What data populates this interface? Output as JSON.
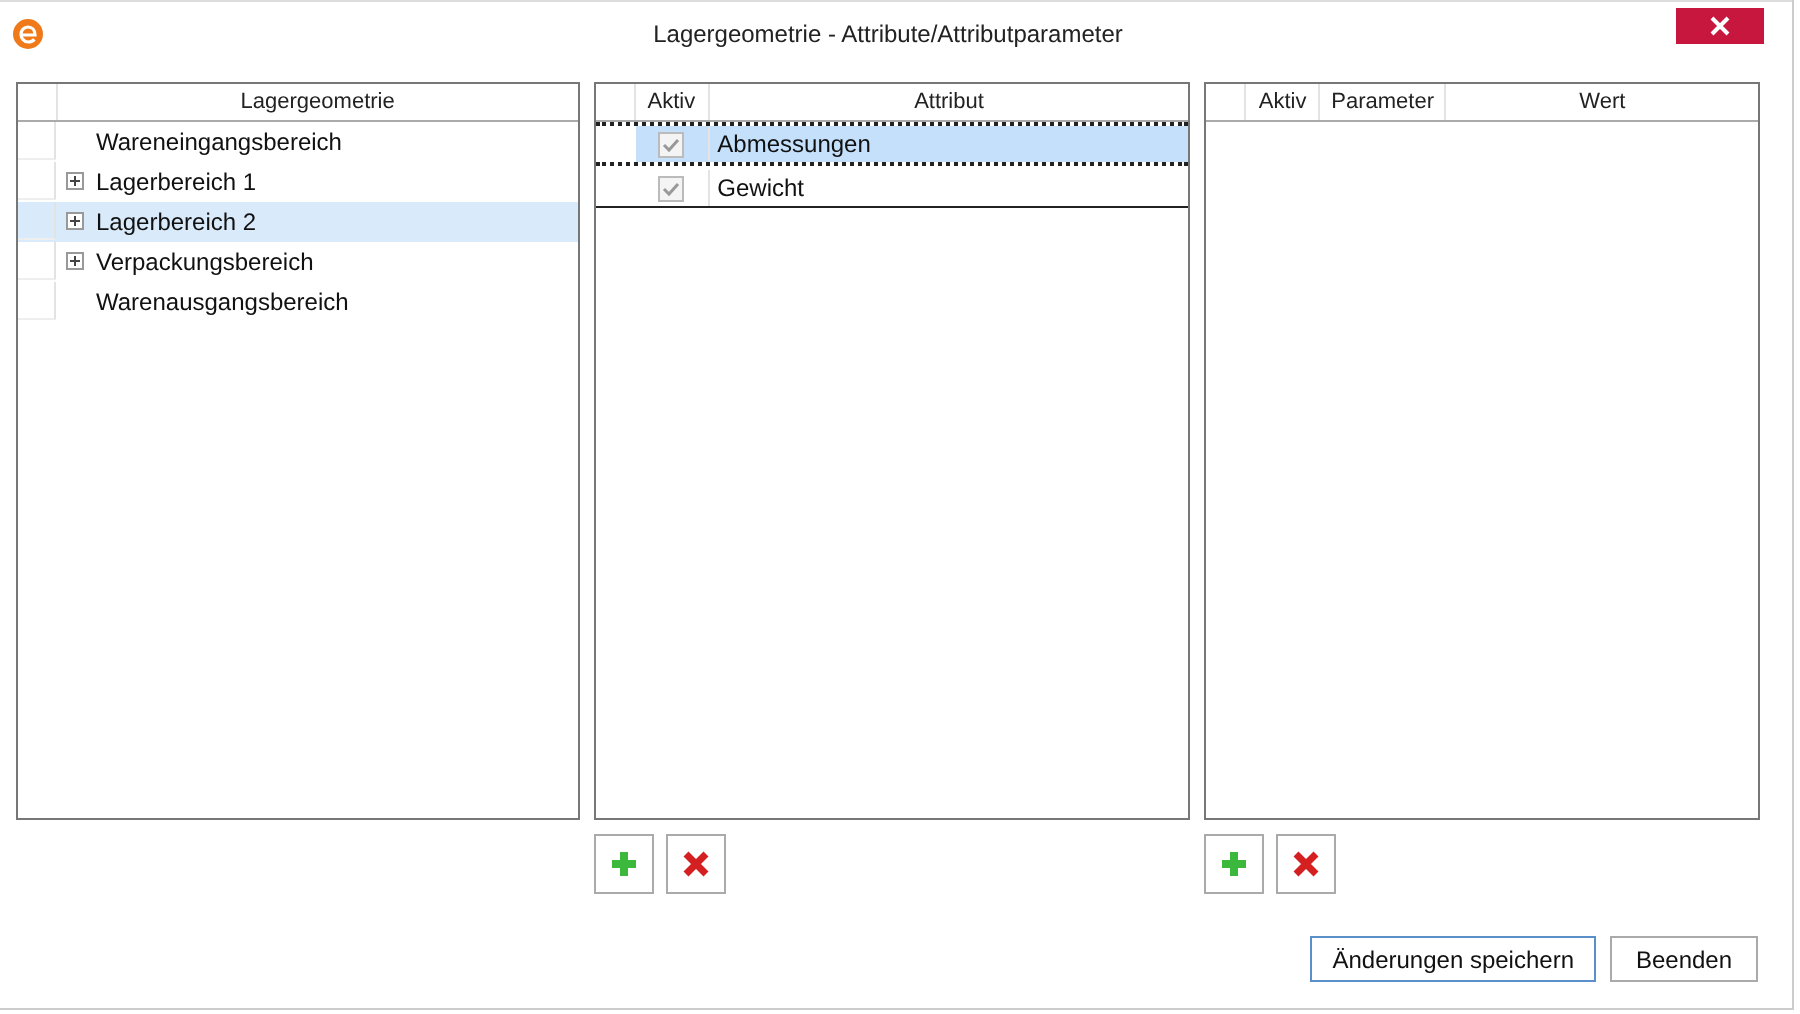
{
  "window": {
    "title": "Lagergeometrie - Attribute/Attributparameter"
  },
  "geometry": {
    "columns": [
      "Lagergeometrie"
    ],
    "items": [
      {
        "label": "Wareneingangsbereich",
        "expandable": false,
        "selected": false
      },
      {
        "label": "Lagerbereich 1",
        "expandable": true,
        "selected": false
      },
      {
        "label": "Lagerbereich 2",
        "expandable": true,
        "selected": true
      },
      {
        "label": "Verpackungsbereich",
        "expandable": true,
        "selected": false
      },
      {
        "label": "Warenausgangsbereich",
        "expandable": false,
        "selected": false
      }
    ]
  },
  "attributes": {
    "columns": [
      "Aktiv",
      "Attribut"
    ],
    "rows": [
      {
        "name": "Abmessungen",
        "checked": true,
        "selected": true
      },
      {
        "name": "Gewicht",
        "checked": true,
        "selected": false
      }
    ]
  },
  "parameters": {
    "columns": [
      "Aktiv",
      "Parameter",
      "Wert"
    ]
  },
  "buttons": [
    "Änderungen speichern",
    "Beenden"
  ]
}
